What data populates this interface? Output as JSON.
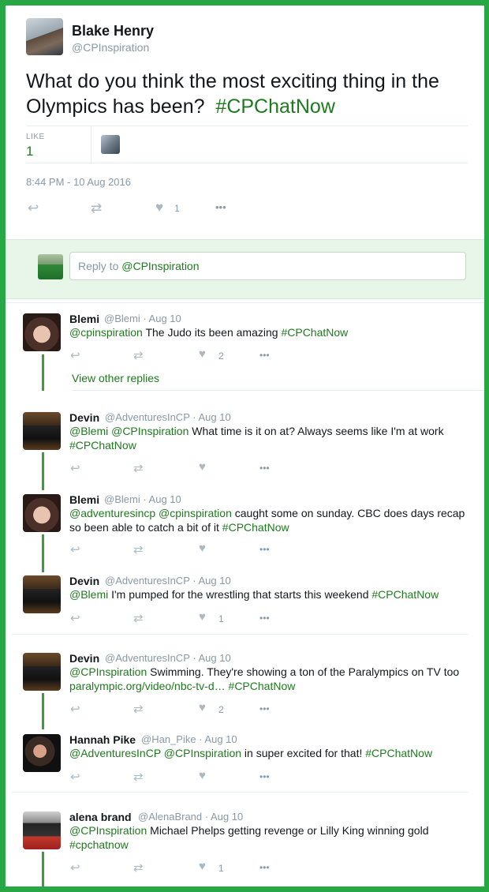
{
  "main_tweet": {
    "name": "Blake Henry",
    "handle": "@CPInspiration",
    "text": "What do you think the most exciting thing in the Olympics has been?",
    "hashtag": "#CPChatNow",
    "like_label": "LIKE",
    "like_count": "1",
    "date": "8:44 PM - 10 Aug 2016",
    "heart_count": "1"
  },
  "reply_box": {
    "prefix": "Reply to ",
    "handle": "@CPInspiration"
  },
  "icons": {
    "reply": "↩",
    "retweet": "⇄",
    "like": "♥",
    "more": "•••"
  },
  "view_other_replies": "View other replies",
  "replies": [
    {
      "name": "Blemi",
      "handle": "@Blemi",
      "date": "Aug 10",
      "mentions": "@cpinspiration",
      "text": " The Judo its been amazing ",
      "tag": "#CPChatNow",
      "likes": "2"
    },
    {
      "name": "Devin",
      "handle": "@AdventuresInCP",
      "date": "Aug 10",
      "mentions": "@Blemi @CPInspiration",
      "text": " What time is it on at? Always seems like I'm at work",
      "tag": "#CPChatNow",
      "likes": ""
    },
    {
      "name": "Blemi",
      "handle": "@Blemi",
      "date": "Aug 10",
      "mentions": "@adventuresincp @cpinspiration",
      "text": " caught some on sunday. CBC does days recap so been able to catch a bit of it ",
      "tag": "#CPChatNow",
      "likes": ""
    },
    {
      "name": "Devin",
      "handle": "@AdventuresInCP",
      "date": "Aug 10",
      "mentions": "@Blemi",
      "text": " I'm pumped for the wrestling that starts this weekend ",
      "tag": "#CPChatNow",
      "likes": "1"
    },
    {
      "name": "Devin",
      "handle": "@AdventuresInCP",
      "date": "Aug 10",
      "mentions": "@CPInspiration",
      "text": " Swimming. They're showing a ton of the Paralympics on TV too",
      "link": "paralympic.org/video/nbc-tv-d…",
      "tag": "#CPChatNow",
      "likes": "2"
    },
    {
      "name": "Hannah Pike",
      "handle": "@Han_Pike",
      "date": "Aug 10",
      "mentions": "@AdventuresInCP @CPInspiration",
      "text": " in super excited for that! ",
      "tag": "#CPChatNow",
      "likes": ""
    },
    {
      "name": "alena brand",
      "handle": "@AlenaBrand",
      "date": "Aug 10",
      "mentions": "@CPInspiration",
      "text": " Michael Phelps getting revenge or Lilly King winning gold",
      "tag": "#cpchatnow",
      "likes": "1"
    }
  ]
}
